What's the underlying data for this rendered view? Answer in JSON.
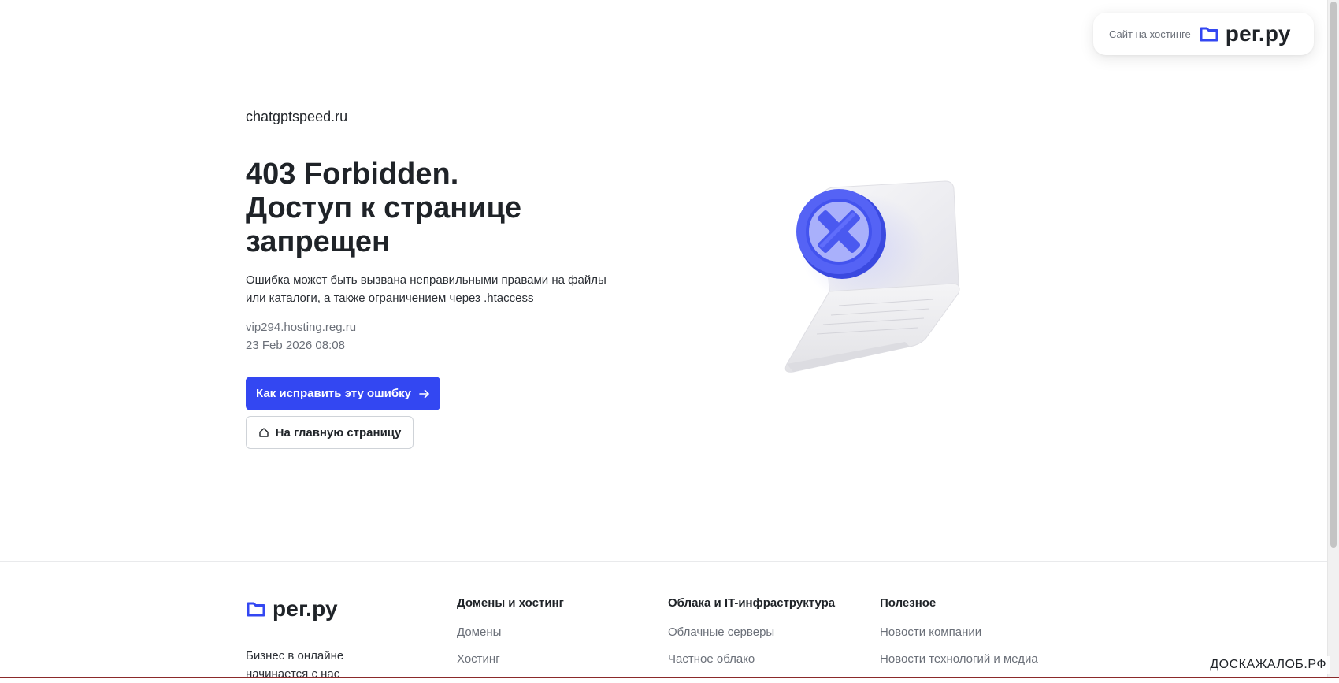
{
  "badge": {
    "text": "Сайт на хостинге",
    "brand": "рег.ру"
  },
  "main": {
    "domain": "chatgptspeed.ru",
    "heading_lines": [
      "403 Forbidden.",
      "Доступ к странице",
      "запрещен"
    ],
    "description": "Ошибка может быть вызвана неправильными правами на файлы или каталоги, а также ограничением через .htaccess",
    "server": "vip294.hosting.reg.ru",
    "datetime": "23 Feb 2026 08:08",
    "primary_button": "Как исправить эту ошибку",
    "secondary_button": "На главную страницу"
  },
  "colors": {
    "accent": "#3347f2",
    "text": "#1f2328",
    "muted": "#6b7079"
  },
  "footer": {
    "brand": "рег.ру",
    "tagline": "Бизнес в онлайне начинается с нас",
    "columns": [
      {
        "title": "Домены и хостинг",
        "links": [
          "Домены",
          "Хостинг"
        ]
      },
      {
        "title": "Облака и IT-инфраструктура",
        "links": [
          "Облачные серверы",
          "Частное облако"
        ]
      },
      {
        "title": "Полезное",
        "links": [
          "Новости компании",
          "Новости технологий и медиа"
        ]
      }
    ]
  },
  "watermark": "ДОСКАЖАЛОБ.РФ"
}
